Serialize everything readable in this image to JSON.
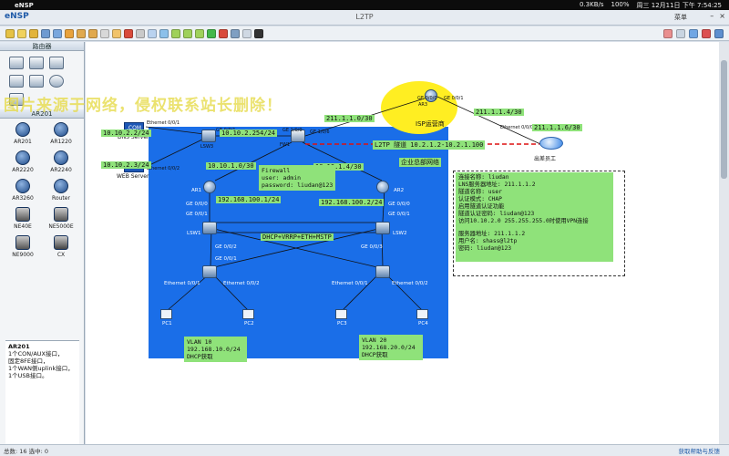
{
  "menubar": {
    "app_name": "eNSP",
    "net_rate": "0.3KB/s",
    "battery": "100%",
    "clock": "周三 12月11日 下午 7:54:25"
  },
  "window": {
    "app_name": "eNSP",
    "title": "L2TP",
    "menu_label": "菜单",
    "minimize": "–",
    "close": "×"
  },
  "sidebar": {
    "router_section": "路由器",
    "model_section": "AR201",
    "devices": [
      "AR201",
      "AR1220",
      "AR2220",
      "AR2240",
      "AR3260",
      "Router",
      "NE40E",
      "NE5000E",
      "NE9000",
      "CX"
    ],
    "desc_title": "AR201",
    "desc_lines": [
      "1个CON/AUX接口，",
      "固定8FE接口，",
      "1个WAN侧uplink接口，",
      "1个USB接口。"
    ]
  },
  "watermark": "图片来源于网络，侵权联系站长删除！",
  "topology": {
    "labels": {
      "dns_server": "DNS Server",
      "web_server": "WEB Server",
      "lsw3": "LSW3",
      "fw1": "FW1",
      "ar1": "AR1",
      "ar2": "AR2",
      "lsw1": "LSW1",
      "lsw2": "LSW2",
      "ar_isp": "AR3",
      "isp_caption": "ISP运营商",
      "remote_caption": "出差员工",
      "enterprise_caption": "企业总部网络",
      "pc1": "PC1",
      "pc2": "PC2",
      "pc3": "PC3",
      "pc4": "PC4",
      "eth_dns": "Ethernet 0/0/1",
      "eth_web": "Ethernet 0/0/2",
      "ge_lsw3_fw": "GE 0/0/1",
      "ge_fw_left": "GE 1/0/6",
      "ge_fw_right": "GE 1/0/0",
      "ge_ar3_left": "GE 0/0/0",
      "ge_ar3_right": "GE 0/0/1",
      "eth_remote": "Ethernet 0/0/0",
      "ge_ar1_a": "GE 0/0/0",
      "ge_ar1_b": "GE 0/0/1",
      "ge_ar2_a": "GE 0/0/0",
      "ge_ar2_b": "GE 0/0/1",
      "ge_lsw1": "GE 0/0/2",
      "ge_lsw2": "GE 0/0/3",
      "ge_acc1": "GE 0/0/1",
      "eth_pc_a": "Ethernet 0/0/1",
      "eth_pc_b": "Ethernet 0/0/2"
    },
    "ips": {
      "dns_ip": "10.10.2.2/24",
      "web_ip": "10.10.2.3/24",
      "lsw3_ip": "10.10.2.254/24",
      "fw_inside": "10.10.1.0/30",
      "fw_outside": "211.1.1.0/30",
      "fw_dmz": "10.10.1.4/30",
      "isp_remote": "211.1.1.4/30",
      "remote_ip": "211.1.1.6/30",
      "ar1_ip": "192.168.100.1/24",
      "ar2_ip": "192.168.100.2/24",
      "tunnel": "L2TP 隧道 10.2.1.2-10.2.1.100",
      "mstp": "DHCP+VRRP+ETH+MSTP"
    },
    "firewall_box": [
      "Firewall",
      "user: admin",
      "password: liudan@123"
    ],
    "vlan10": [
      "VLAN 10",
      "192.168.10.0/24",
      "DHCP获取"
    ],
    "vlan20": [
      "VLAN 20",
      "192.168.20.0/24",
      "DHCP获取"
    ],
    "l2tp_config": [
      "连接名称: liudan",
      "LNS服务器地址: 211.1.1.2",
      "隧道名称: user",
      "认证模式: CHAP",
      "启用隧道认证功能",
      "隧道认证密码: liudan@123",
      "访问10.10.2.0 255.255.255.0时使用VPN连接",
      "",
      "服务器地址: 211.1.1.2",
      "用户名: shass@l2tp",
      "密码: liudan@123"
    ]
  },
  "statusbar": {
    "info": "总数: 16 选中: 0",
    "help": "获取帮助与反馈"
  },
  "colors": {
    "enterprise_bg": "#1a6ee8",
    "label_green": "#8fe27a",
    "isp_yellow": "#ffee22",
    "tunnel_red": "#dd1111"
  }
}
